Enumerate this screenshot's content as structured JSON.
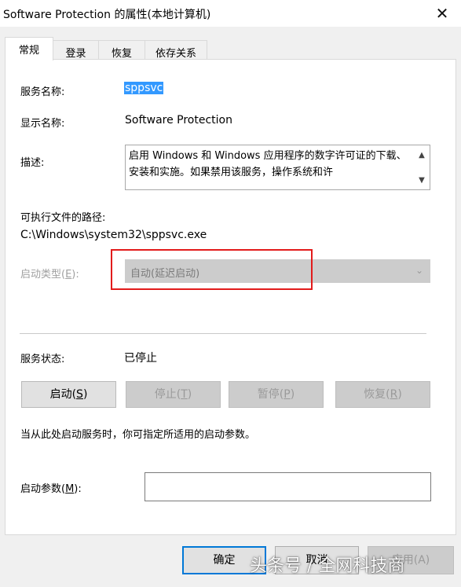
{
  "window": {
    "title": "Software Protection 的属性(本地计算机)",
    "close_glyph": "✕"
  },
  "tabs": [
    {
      "label": "常规",
      "active": true
    },
    {
      "label": "登录",
      "active": false
    },
    {
      "label": "恢复",
      "active": false
    },
    {
      "label": "依存关系",
      "active": false
    }
  ],
  "general": {
    "service_name_label": "服务名称:",
    "service_name": "sppsvc",
    "display_name_label": "显示名称:",
    "display_name": "Software Protection",
    "description_label": "描述:",
    "description": "启用 Windows 和 Windows 应用程序的数字许可证的下载、安装和实施。如果禁用该服务，操作系统和许",
    "exe_path_label": "可执行文件的路径:",
    "exe_path": "C:\\Windows\\system32\\sppsvc.exe",
    "startup_type_label": "启动类型(",
    "startup_type_key": "E",
    "startup_type_suffix": "):",
    "startup_type_value": "自动(延迟启动)",
    "service_status_label": "服务状态:",
    "service_status": "已停止",
    "hint": "当从此处启动服务时，你可指定所适用的启动参数。",
    "start_params_label_prefix": "启动参数(",
    "start_params_key": "M",
    "start_params_label_suffix": "):",
    "start_params_value": ""
  },
  "service_buttons": [
    {
      "prefix": "启动(",
      "key": "S",
      "suffix": ")",
      "enabled": true
    },
    {
      "prefix": "停止(",
      "key": "T",
      "suffix": ")",
      "enabled": false
    },
    {
      "prefix": "暂停(",
      "key": "P",
      "suffix": ")",
      "enabled": false
    },
    {
      "prefix": "恢复(",
      "key": "R",
      "suffix": ")",
      "enabled": false
    }
  ],
  "dialog_buttons": {
    "ok": "确定",
    "cancel": "取消",
    "apply": "应用(A)"
  },
  "watermark": "头条号 / 全网科技商",
  "colors": {
    "selection": "#3399ff",
    "highlight_box": "#e21b1b",
    "primary_border": "#0078d7"
  }
}
